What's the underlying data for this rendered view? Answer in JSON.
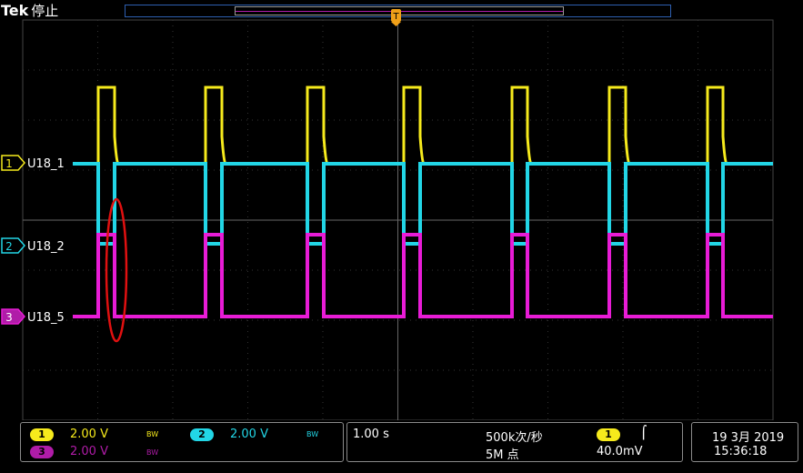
{
  "header": {
    "brand": "Tek",
    "status": "停止",
    "trigger_marker": "T"
  },
  "channels": [
    {
      "num": "1",
      "label": "U18_1",
      "color": "#f6ea1c"
    },
    {
      "num": "2",
      "label": "U18_2",
      "color": "#22d6e6"
    },
    {
      "num": "3",
      "label": "U18_5",
      "color": "#e81cd6"
    }
  ],
  "status_bar": {
    "ch1": {
      "num": "1",
      "scale": "2.00 V",
      "bw": "BW",
      "color": "#f6ea1c"
    },
    "ch2": {
      "num": "2",
      "scale": "2.00 V",
      "bw": "BW",
      "color": "#22d6e6"
    },
    "ch3": {
      "num": "3",
      "scale": "2.00 V",
      "bw": "BW",
      "color": "#b01ca8"
    },
    "timebase": "1.00 s",
    "sample_rate": "500k次/秒",
    "record_length": "5M 点",
    "trigger": {
      "source": "1",
      "slope": "⌠",
      "level": "40.0mV"
    },
    "date": "19 3月 2019",
    "time": "15:36:18"
  },
  "annotation": {
    "color": "#e01010"
  }
}
